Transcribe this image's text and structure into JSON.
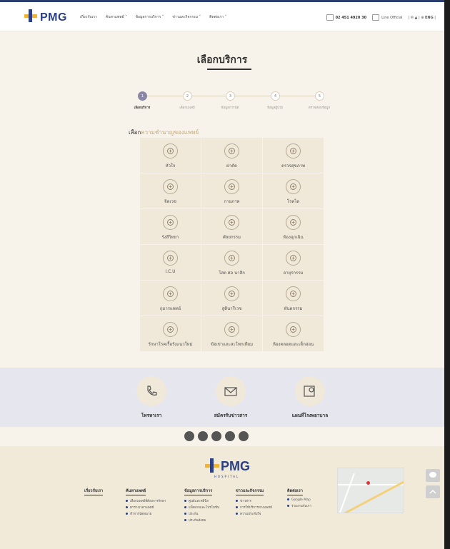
{
  "header": {
    "nav": [
      "เกี่ยวกับเรา",
      "ค้นหาแพทย์ ˅",
      "ข้อมูลการบริการ ˅",
      "ข่าวและกิจกรรม ˅",
      "ติดต่อเรา ˅"
    ],
    "phone": "02 451 4920 30",
    "line": "Line Official",
    "lang": "ENG"
  },
  "logo": {
    "text": "PMG",
    "sub": "HOSPITAL"
  },
  "page_title": "เลือกบริการ",
  "steps": [
    {
      "num": "1",
      "label": "เลือกบริการ",
      "active": true
    },
    {
      "num": "2",
      "label": "เลือกแพทย์",
      "active": false
    },
    {
      "num": "3",
      "label": "ข้อมูลการนัด",
      "active": false
    },
    {
      "num": "4",
      "label": "ข้อมูลผู้ป่วย",
      "active": false
    },
    {
      "num": "5",
      "label": "ตรวจสอบข้อมูล",
      "active": false
    }
  ],
  "section_heading": {
    "lead": "เลือก",
    "rest": "ความชำนาญของแพทย์"
  },
  "services": [
    {
      "label": "หัวใจ",
      "icon": "heart-icon"
    },
    {
      "label": "ผ่าตัด",
      "icon": "scalpel-icon"
    },
    {
      "label": "ตรวจสุขภาพ",
      "icon": "stethoscope-icon"
    },
    {
      "label": "จิตเวช",
      "icon": "brain-icon"
    },
    {
      "label": "กายภาพ",
      "icon": "foot-icon"
    },
    {
      "label": "โรคไต",
      "icon": "kidney-icon"
    },
    {
      "label": "รังสีวิทยา",
      "icon": "xray-icon"
    },
    {
      "label": "ศัลยกรรม",
      "icon": "surgery-icon"
    },
    {
      "label": "ห้องฉุกเฉิน",
      "icon": "ambulance-icon"
    },
    {
      "label": "I.C.U",
      "icon": "icu-icon"
    },
    {
      "label": "โสต ศอ นาสิก",
      "icon": "ent-icon"
    },
    {
      "label": "อายุรกรรม",
      "icon": "medicine-icon"
    },
    {
      "label": "กุมารแพทย์",
      "icon": "baby-icon"
    },
    {
      "label": "สูตินารีเวช",
      "icon": "pregnancy-icon"
    },
    {
      "label": "ทันตกรรม",
      "icon": "tooth-icon"
    },
    {
      "label": "รักษาโรคเรื้อรังแนวใหม่",
      "icon": "chronic-icon"
    },
    {
      "label": "ข้อเข่าและสะโพกเทียม",
      "icon": "joint-icon"
    },
    {
      "label": "ห้องคลอดและเด็กอ่อน",
      "icon": "delivery-icon"
    }
  ],
  "contacts": [
    {
      "label": "โทรหาเรา",
      "icon": "phone-icon"
    },
    {
      "label": "สมัครรับข่าวสาร",
      "icon": "mail-icon"
    },
    {
      "label": "แผนที่โรงพยาบาล",
      "icon": "map-icon"
    }
  ],
  "socials": [
    "facebook-icon",
    "twitter-icon",
    "youtube-icon",
    "instagram-icon",
    "line-icon"
  ],
  "footer": {
    "about": "เกี่ยวกับเรา",
    "cols": [
      {
        "head": "ค้นหาแพทย์",
        "items": [
          "เลือกแพทย์ที่ต้องการรักษา",
          "ตารางเวลาแพทย์",
          "ทำการนัดหมาย"
        ]
      },
      {
        "head": "ข้อมูลการบริการ",
        "items": [
          "ศูนย์และคลินิก",
          "แพ็คเกจและโปรโมชั่น",
          "ประกัน",
          "ประกันสังคม"
        ]
      },
      {
        "head": "ข่าวและกิจกรรม",
        "items": [
          "ข่าวสาร",
          "การให้บริการทางแพทย์",
          "ความประทับใจ"
        ]
      },
      {
        "head": "ติดต่อเรา",
        "items": [
          "Google Map",
          "ร่วมงานกับเรา"
        ]
      }
    ]
  }
}
